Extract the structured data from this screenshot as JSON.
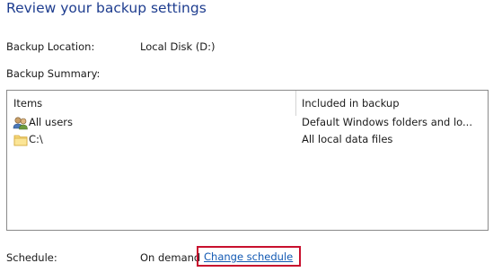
{
  "page": {
    "title": "Review your backup settings"
  },
  "settings": {
    "location_label": "Backup Location:",
    "location_value": "Local Disk (D:)",
    "summary_label": "Backup Summary:"
  },
  "summary_table": {
    "columns": [
      "Items",
      "Included in backup"
    ],
    "rows": [
      {
        "icon": "users-icon",
        "name": "All users",
        "included": "Default Windows folders and lo..."
      },
      {
        "icon": "folder-icon",
        "name": "C:\\",
        "included": "All local data files"
      }
    ]
  },
  "schedule": {
    "label": "Schedule:",
    "value": "On demand",
    "change_link": "Change schedule",
    "highlight_color": "#c8102e"
  }
}
